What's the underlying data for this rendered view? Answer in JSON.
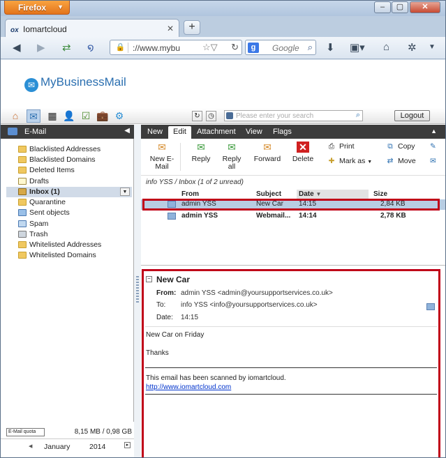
{
  "browser": {
    "menu_label": "Firefox",
    "tab_title": "Iomartcloud",
    "tab_favicon_text": "ox",
    "address": "://www.mybu",
    "search_engine_placeholder": "Google"
  },
  "app": {
    "brand": "MyBusinessMail",
    "search_placeholder": "Please enter your search",
    "logout_label": "Logout"
  },
  "sidebar": {
    "header": "E-Mail",
    "folders": [
      {
        "label": "Blacklisted Addresses"
      },
      {
        "label": "Blacklisted Domains"
      },
      {
        "label": "Deleted Items"
      },
      {
        "label": "Drafts"
      },
      {
        "label": "Inbox (1)",
        "selected": true
      },
      {
        "label": "Quarantine"
      },
      {
        "label": "Sent objects"
      },
      {
        "label": "Spam"
      },
      {
        "label": "Trash"
      },
      {
        "label": "Whitelisted Addresses"
      },
      {
        "label": "Whitelisted Domains"
      }
    ],
    "quota_label": "E-Mail quota",
    "quota_value": "8,15 MB / 0,98 GB",
    "calendar_month": "January",
    "calendar_year": "2014"
  },
  "tabs": [
    {
      "label": "New"
    },
    {
      "label": "Edit",
      "active": true
    },
    {
      "label": "Attachment"
    },
    {
      "label": "View"
    },
    {
      "label": "Flags"
    }
  ],
  "ribbon": {
    "new_email": "New E-Mail",
    "reply": "Reply",
    "reply_all": "Reply all",
    "forward": "Forward",
    "delete": "Delete",
    "print": "Print",
    "mark_as": "Mark as",
    "copy": "Copy",
    "move": "Move"
  },
  "breadcrumb": "info YSS / Inbox (1 of 2 unread)",
  "columns": {
    "from": "From",
    "subject": "Subject",
    "date": "Date",
    "size": "Size"
  },
  "messages": [
    {
      "from": "admin YSS",
      "subject": "New Car",
      "date": "14:15",
      "size": "2,84 KB",
      "selected": true,
      "unread": false
    },
    {
      "from": "admin YSS",
      "subject": "Webmail...",
      "date": "14:14",
      "size": "2,78 KB",
      "selected": false,
      "unread": true
    }
  ],
  "preview": {
    "subject": "New Car",
    "from_label": "From:",
    "from_value": "admin YSS <admin@yoursupportservices.co.uk>",
    "to_label": "To:",
    "to_value": "info YSS <info@yoursupportservices.co.uk>",
    "date_label": "Date:",
    "date_value": "14:15",
    "body_line1": "New Car on Friday",
    "body_line2": "Thanks",
    "scan_text": "This email has been scanned by iomartcloud.",
    "scan_link": "http://www.iomartcloud.com"
  },
  "colors": {
    "highlight": "#c00018",
    "accent": "#2b6fb0",
    "firefox": "#e3741c"
  }
}
